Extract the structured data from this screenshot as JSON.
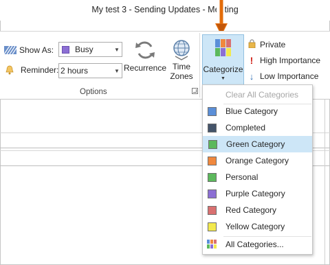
{
  "window": {
    "title": "My test 3 - Sending Updates - Meeting"
  },
  "options_group": {
    "show_as_label": "Show As:",
    "show_as_value": "Busy",
    "reminder_label": "Reminder:",
    "reminder_value": "2 hours",
    "recurrence_label": "Recurrence",
    "time_zones_label_1": "Time",
    "time_zones_label_2": "Zones",
    "group_label": "Options"
  },
  "tags_group": {
    "categorize_label": "Categorize",
    "private_label": "Private",
    "high_importance_label": "High Importance",
    "low_importance_label": "Low Importance"
  },
  "categorize_menu": {
    "clear_all": "Clear All Categories",
    "items": [
      {
        "label": "Blue Category",
        "color": "#5b8fd8"
      },
      {
        "label": "Completed",
        "color": "#44546a"
      },
      {
        "label": "Green Category",
        "color": "#5cb85c"
      },
      {
        "label": "Orange Category",
        "color": "#f0883e"
      },
      {
        "label": "Personal",
        "color": "#5cb85c"
      },
      {
        "label": "Purple Category",
        "color": "#8c6fd4"
      },
      {
        "label": "Red Category",
        "color": "#d97070"
      },
      {
        "label": "Yellow Category",
        "color": "#f2e94e"
      }
    ],
    "all_categories": "All Categories...",
    "highlighted_item": "Green Category"
  },
  "colors": {
    "accent_highlight": "#cde6f7",
    "pointer_arrow": "#e36c0a",
    "busy_swatch": "#8c6fd4"
  }
}
